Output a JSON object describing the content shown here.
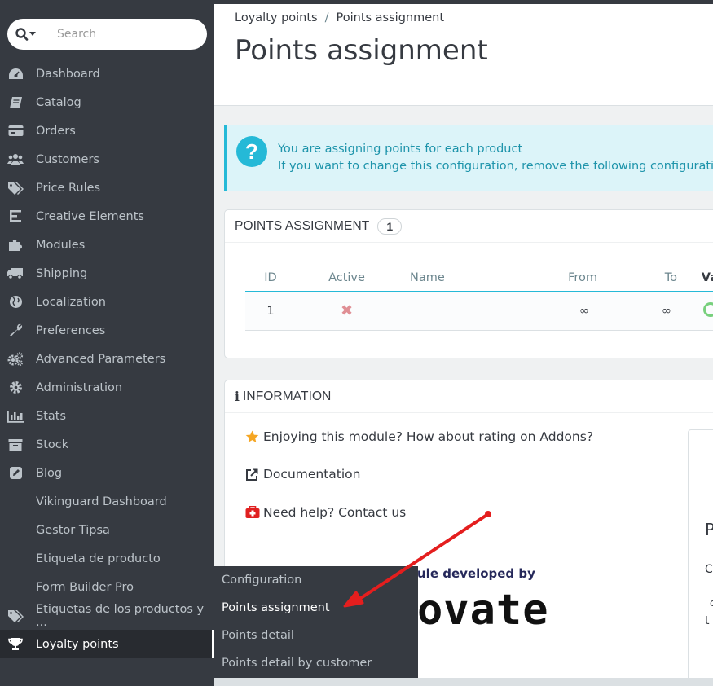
{
  "search": {
    "placeholder": "Search"
  },
  "sidebar": {
    "items": [
      {
        "label": "Dashboard",
        "icon": "dashboard-icon"
      },
      {
        "label": "Catalog",
        "icon": "catalog-icon"
      },
      {
        "label": "Orders",
        "icon": "orders-icon"
      },
      {
        "label": "Customers",
        "icon": "customers-icon"
      },
      {
        "label": "Price Rules",
        "icon": "tags-icon"
      },
      {
        "label": "Creative Elements",
        "icon": "creative-elements-icon"
      },
      {
        "label": "Modules",
        "icon": "puzzle-icon"
      },
      {
        "label": "Shipping",
        "icon": "truck-icon"
      },
      {
        "label": "Localization",
        "icon": "globe-icon"
      },
      {
        "label": "Preferences",
        "icon": "wrench-icon"
      },
      {
        "label": "Advanced Parameters",
        "icon": "gears-icon"
      },
      {
        "label": "Administration",
        "icon": "gear-icon"
      },
      {
        "label": "Stats",
        "icon": "bar-chart-icon"
      },
      {
        "label": "Stock",
        "icon": "archive-icon"
      },
      {
        "label": "Blog",
        "icon": "edit-icon"
      },
      {
        "label": "Vikinguard Dashboard"
      },
      {
        "label": "Gestor Tipsa"
      },
      {
        "label": "Etiqueta de producto"
      },
      {
        "label": "Form Builder Pro"
      },
      {
        "label": "Etiquetas de los productos y ...",
        "icon": "tags-icon"
      },
      {
        "label": "Loyalty points",
        "icon": "trophy-icon"
      }
    ]
  },
  "submenu": {
    "items": [
      "Configuration",
      "Points assignment",
      "Points detail",
      "Points detail by customer"
    ]
  },
  "header": {
    "breadcrumb": [
      "Loyalty points",
      "Points assignment"
    ],
    "breadcrumb_sep": "/",
    "title": "Points assignment"
  },
  "alert": {
    "line1": "You are assigning points for each product",
    "line2": "If you want to change this configuration, remove the following configurations"
  },
  "points_panel": {
    "title": "POINTS ASSIGNMENT",
    "count": "1",
    "columns": [
      "ID",
      "Active",
      "Name",
      "From",
      "To",
      "Va"
    ],
    "rows": [
      {
        "id": "1",
        "active": "✖",
        "name": "",
        "from": "∞",
        "to": "∞"
      }
    ]
  },
  "info_panel": {
    "title": "INFORMATION",
    "items": [
      "Enjoying this module? How about rating on Addons?",
      "Documentation",
      "Need help? Contact us"
    ],
    "developed_by": "ule developed by",
    "logo": "ovate",
    "right_card": [
      "P",
      "C",
      "c",
      "t"
    ]
  },
  "colors": {
    "sidebar_bg": "#363a41",
    "accent": "#25b9d7",
    "alert_bg": "#dcf4f9",
    "arrow": "#e41e1e"
  }
}
